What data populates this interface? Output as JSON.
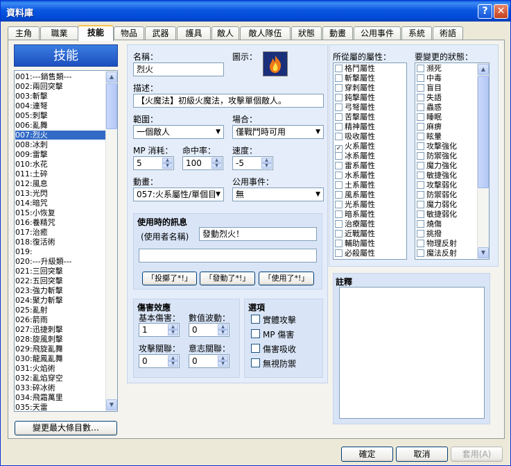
{
  "window": {
    "title": "資料庫",
    "help": "?",
    "close": "✕"
  },
  "tabs": [
    "主角",
    "職業",
    "技能",
    "物品",
    "武器",
    "護具",
    "敵人",
    "敵人隊伍",
    "狀態",
    "動畫",
    "公用事件",
    "系統",
    "術語"
  ],
  "left": {
    "header": "技能",
    "change_max_button": "變更最大條目數…",
    "items": [
      "001:---銷售類---",
      "002:兩回突擊",
      "003:斬擊",
      "004:連弩",
      "005:刺擊",
      "006:亂舞",
      "007:烈火",
      "008:冰刺",
      "009:雷擊",
      "010:水花",
      "011:土碎",
      "012:風息",
      "013:光閃",
      "014:暗咒",
      "015:小恢复",
      "016:養精咒",
      "017:治癒",
      "018:復活術",
      "019:",
      "020:---升級類---",
      "021:三回突擊",
      "022:五回突擊",
      "023:強力斬擊",
      "024:聚力斬擊",
      "025:亂射",
      "026:箭雨",
      "027:迅捷刺擊",
      "028:旋風刺擊",
      "029:飛旋亂舞",
      "030:龍鳳亂舞",
      "031:火焰術",
      "032:亂焰穿空",
      "033:碎冰術",
      "034:飛霜萬里",
      "035:天雷"
    ]
  },
  "form": {
    "name_label": "名稱：",
    "name_value": "烈火",
    "icon_label": "圖示：",
    "icon_name": "fire-icon",
    "desc_label": "描述：",
    "desc_value": "【火魔法】初級火魔法，攻擊單個敵人。",
    "scope_label": "範圍：",
    "scope_value": "一個敵人",
    "occasion_label": "場合：",
    "occasion_value": "僅戰鬥時可用",
    "mp_label": "MP 消耗：",
    "mp_value": "5",
    "hit_label": "命中率：",
    "hit_value": "100",
    "speed_label": "速度：",
    "speed_value": "-5",
    "anim_label": "動畫：",
    "anim_value": "057:火系屬性/單個目",
    "event_label": "公用事件：",
    "event_value": "無"
  },
  "message": {
    "title": "使用時的訊息",
    "user_label": "(使用者名稱)",
    "line1": "發動烈火！",
    "line2": "",
    "btn_throw": "「投擲了*!」",
    "btn_activate": "「發動了*!」",
    "btn_use": "「使用了*!」"
  },
  "damage": {
    "title": "傷害效應",
    "base_label": "基本傷害：",
    "base_value": "1",
    "var_label": "數值波動：",
    "var_value": "0",
    "atk_label": "攻擊關聯：",
    "atk_value": "0",
    "int_label": "意志關聯：",
    "int_value": "0"
  },
  "options": {
    "title": "選項",
    "items": [
      "實體攻擊",
      "MP 傷害",
      "傷害吸收",
      "無視防禦"
    ]
  },
  "elements": {
    "title": "所從屬的屬性：",
    "items": [
      "格鬥屬性",
      "斬擊屬性",
      "穿刺屬性",
      "鈍擊屬性",
      "弓弩屬性",
      "苦擊屬性",
      "精神屬性",
      "吸收屬性",
      "火系屬性",
      "冰系屬性",
      "雷系屬性",
      "水系屬性",
      "土系屬性",
      "風系屬性",
      "光系屬性",
      "暗系屬性",
      "治療屬性",
      "近戰屬性",
      "輔助屬性",
      "必殺屬性"
    ],
    "checked_index": 8,
    "check_mark": "✓"
  },
  "states": {
    "title": "要變更的狀態：",
    "items": [
      "濒死",
      "中毒",
      "盲目",
      "失語",
      "蟲惑",
      "睡眠",
      "麻痹",
      "眩暈",
      "攻擊強化",
      "防禦強化",
      "魔力強化",
      "敏捷強化",
      "攻擊弱化",
      "防禦弱化",
      "魔力弱化",
      "敏捷弱化",
      "燒傷",
      "挑撥",
      "物理反射",
      "魔法反射"
    ]
  },
  "notes": {
    "title": "註釋"
  },
  "footer": {
    "ok": "確定",
    "cancel": "取消",
    "apply": "套用(A)"
  }
}
